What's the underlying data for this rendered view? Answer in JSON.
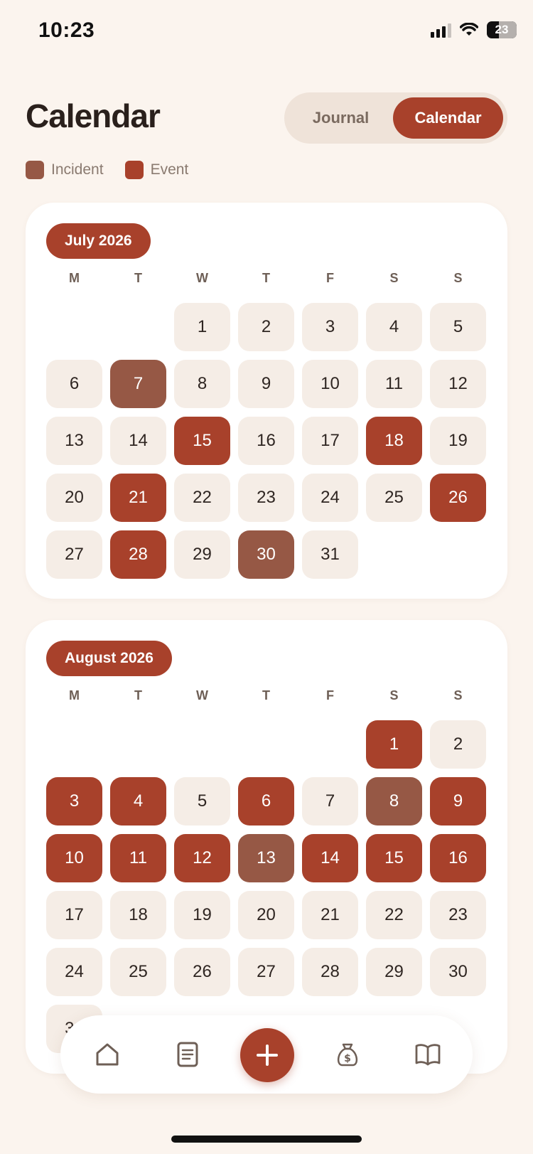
{
  "status_bar": {
    "time": "10:23",
    "battery": "23",
    "icons": [
      "cellular-signal-icon",
      "wifi-icon",
      "battery-icon"
    ]
  },
  "header": {
    "title": "Calendar",
    "toggle": {
      "journal_label": "Journal",
      "calendar_label": "Calendar",
      "active": "Calendar"
    }
  },
  "legend": {
    "incident_label": "Incident",
    "event_label": "Event"
  },
  "colors": {
    "background": "#fbf4ee",
    "accent": "#a8412b",
    "event": "#a8412b",
    "incident": "#965845",
    "empty_day": "#f5ede6"
  },
  "weekdays": [
    "M",
    "T",
    "W",
    "T",
    "F",
    "S",
    "S"
  ],
  "months": [
    {
      "title": "July 2026",
      "leading_blanks": 2,
      "days_in_month": 31,
      "event_days": [
        15,
        18,
        21,
        26,
        28
      ],
      "incident_days": [
        7,
        30
      ]
    },
    {
      "title": "August 2026",
      "leading_blanks": 5,
      "days_in_month": 31,
      "event_days": [
        1,
        3,
        4,
        6,
        9,
        10,
        11,
        12,
        14,
        15,
        16
      ],
      "incident_days": [
        8,
        13
      ]
    }
  ],
  "bottom_nav": {
    "items": [
      "home-icon",
      "journal-icon",
      "add-icon",
      "expenses-icon",
      "library-icon"
    ]
  }
}
